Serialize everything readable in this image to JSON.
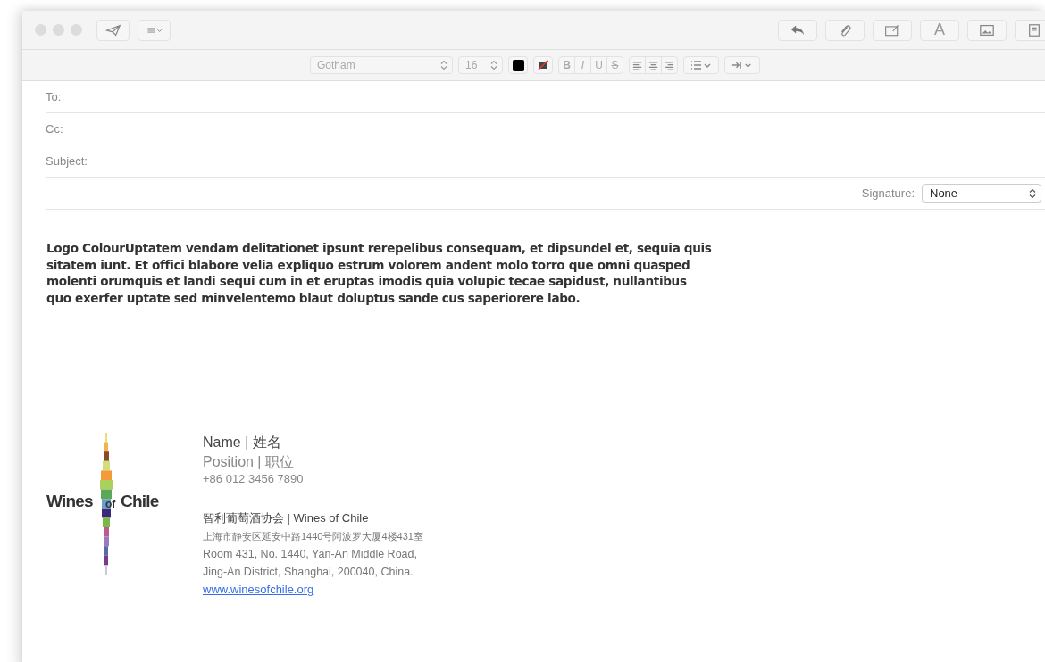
{
  "toolbar": {
    "left_buttons": [
      {
        "kind": "send"
      },
      {
        "kind": "header"
      }
    ],
    "right_buttons": [
      {
        "kind": "reply"
      },
      {
        "kind": "attach"
      },
      {
        "kind": "markup"
      },
      {
        "kind": "fonts",
        "label": "A"
      },
      {
        "kind": "photo"
      },
      {
        "kind": "panel"
      }
    ]
  },
  "format_bar": {
    "font": "Gotham",
    "size": "16",
    "styles": [
      {
        "label": "B",
        "kind": "bold"
      },
      {
        "label": "I",
        "kind": "italic"
      },
      {
        "label": "U",
        "kind": "underline"
      },
      {
        "label": "S",
        "kind": "strike"
      }
    ],
    "aligns": [
      {
        "kind": "left"
      },
      {
        "kind": "center"
      },
      {
        "kind": "right"
      }
    ]
  },
  "fields": [
    {
      "label": "To:"
    },
    {
      "label": "Cc:"
    },
    {
      "label": "Subject:"
    }
  ],
  "signature": {
    "label": "Signature:",
    "value": "None"
  },
  "body": {
    "text": "Logo ColourUptatem vendam delitationet ipsunt rerepelibus consequam, et dipsundel et, sequia quis sitatem iunt. Et offici blabore velia expliquo estrum volorem andent molo torro que omni quasped molenti orumquis et landi sequi cum in et eruptas imodis quia volupic tecae sapidust, nullantibus quo exerfer uptate sed minvelentemo blaut doluptus sande cus saperiorere labo."
  },
  "email_signature": {
    "logo": {
      "word1": "Wines",
      "word2": "of",
      "word3": "Chile"
    },
    "name": "Name | 姓名",
    "position": "Position | 职位",
    "phone": "+86 012 3456 7890",
    "org": "智利葡萄酒协会 | Wines of Chile",
    "address_cn": "上海市静安区延安中路1440号阿波罗大厦4楼431室",
    "address_lines": [
      "Room 431, No. 1440, Yan-An Middle Road,",
      "Jing-An District, Shanghai, 200040, China."
    ],
    "website": "www.winesofchile.org"
  }
}
